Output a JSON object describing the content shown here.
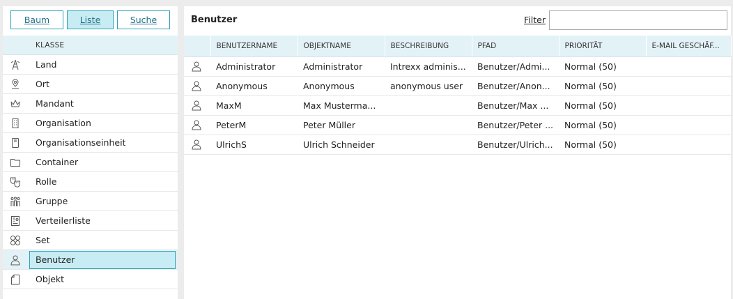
{
  "toolbar": {
    "buttons": [
      {
        "label": "Baum",
        "active": false
      },
      {
        "label": "Liste",
        "active": true
      },
      {
        "label": "Suche",
        "active": false
      }
    ]
  },
  "classes": {
    "header": "KLASSE",
    "items": [
      {
        "label": "Land",
        "icon": "globe-tower-icon"
      },
      {
        "label": "Ort",
        "icon": "location-pin-icon"
      },
      {
        "label": "Mandant",
        "icon": "crown-icon"
      },
      {
        "label": "Organisation",
        "icon": "building-icon"
      },
      {
        "label": "Organisationseinheit",
        "icon": "org-unit-icon"
      },
      {
        "label": "Container",
        "icon": "folder-icon"
      },
      {
        "label": "Rolle",
        "icon": "theater-masks-icon"
      },
      {
        "label": "Gruppe",
        "icon": "group-icon"
      },
      {
        "label": "Verteilerliste",
        "icon": "distribution-list-icon"
      },
      {
        "label": "Set",
        "icon": "set-circles-icon"
      },
      {
        "label": "Benutzer",
        "icon": "user-icon",
        "selected": true
      },
      {
        "label": "Objekt",
        "icon": "document-icon"
      }
    ]
  },
  "main": {
    "title": "Benutzer",
    "filter_label": "Filter",
    "filter_value": "",
    "columns": [
      "BENUTZERNAME",
      "OBJEKTNAME",
      "BESCHREIBUNG",
      "PFAD",
      "PRIORITÄT",
      "E-MAIL GESCHÄF..."
    ],
    "rows": [
      [
        "Administrator",
        "Administrator",
        "Intrexx adminis...",
        "Benutzer/Admi...",
        "Normal (50)",
        ""
      ],
      [
        "Anonymous",
        "Anonymous",
        "anonymous user",
        "Benutzer/Anon...",
        "Normal (50)",
        ""
      ],
      [
        "MaxM",
        "Max Musterma...",
        "",
        "Benutzer/Max ...",
        "Normal (50)",
        ""
      ],
      [
        "PeterM",
        "Peter Müller",
        "",
        "Benutzer/Peter ...",
        "Normal (50)",
        ""
      ],
      [
        "UlrichS",
        "Ulrich Schneider",
        "",
        "Benutzer/Ulrich...",
        "Normal (50)",
        ""
      ]
    ],
    "row_icon": "user-icon"
  },
  "colors": {
    "accent": "#2ba0b8",
    "selected_bg": "#c8ecf3",
    "header_bg": "#e3f2f7"
  }
}
